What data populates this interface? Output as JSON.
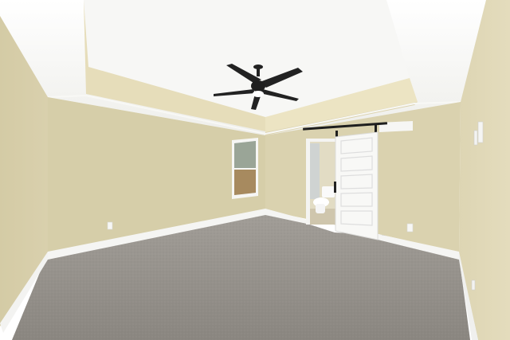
{
  "photo": {
    "subject": "empty-bedroom",
    "palette": {
      "wall": "#d6cdaa",
      "wall_shadow": "#c9bf98",
      "ceiling": "#f2f2f0",
      "tray_band": "#e6ddba",
      "baseboard": "#f4f4f2",
      "carpet": "#8f8b86",
      "door": "#f7f7f5",
      "barn_rail": "#1e1e1e",
      "fan": "#222222",
      "window_glass": "#b8c8a0"
    }
  }
}
